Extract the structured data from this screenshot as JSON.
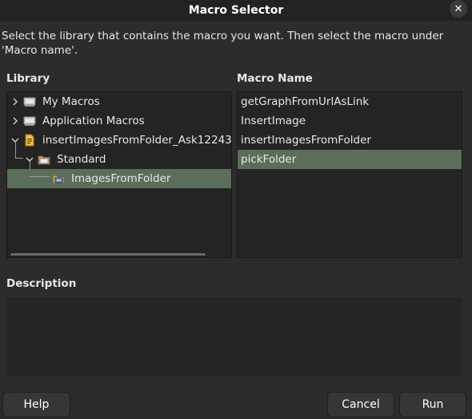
{
  "window": {
    "title": "Macro Selector",
    "close_icon": "close-icon"
  },
  "instructions": "Select the library that contains the macro you want. Then select the macro under 'Macro name'.",
  "library": {
    "label": "Library",
    "items": [
      {
        "label": "My Macros",
        "icon": "macros-library-icon",
        "expander": "collapsed"
      },
      {
        "label": "Application Macros",
        "icon": "macros-library-icon",
        "expander": "collapsed"
      },
      {
        "label": "insertImagesFromFolder_Ask12243",
        "icon": "document-icon",
        "expander": "expanded"
      },
      {
        "label": "Standard",
        "icon": "folder-icon",
        "expander": "expanded"
      },
      {
        "label": "ImagesFromFolder",
        "icon": "module-icon",
        "selected": true
      }
    ]
  },
  "macro_name": {
    "label": "Macro Name",
    "items": [
      {
        "label": "getGraphFromUrlAsLink"
      },
      {
        "label": "InsertImage"
      },
      {
        "label": "insertImagesFromFolder"
      },
      {
        "label": "pickFolder",
        "selected": true
      }
    ]
  },
  "description": {
    "label": "Description",
    "text": ""
  },
  "buttons": {
    "help": "Help",
    "cancel": "Cancel",
    "run": "Run"
  },
  "colors": {
    "background": "#2c2c2c",
    "selection": "#5a6e5a",
    "panel": "#242424"
  }
}
